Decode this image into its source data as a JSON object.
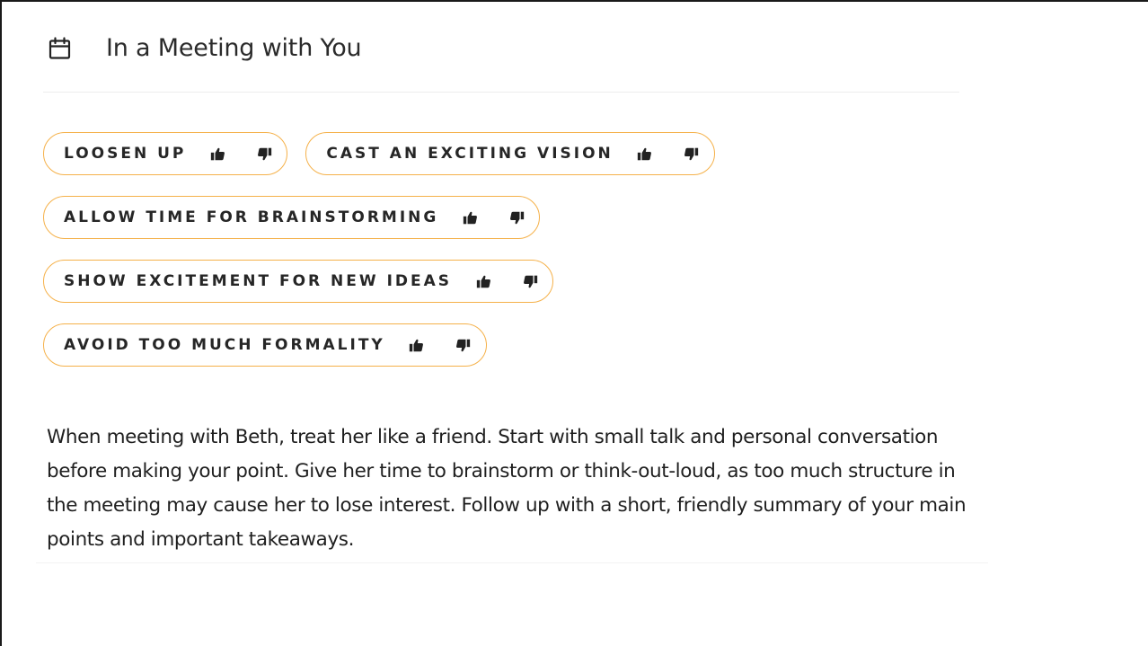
{
  "header": {
    "icon": "calendar-icon",
    "title": "In a Meeting with You"
  },
  "colors": {
    "chip_border": "#f5b14a",
    "text": "#262626"
  },
  "tips": [
    {
      "label": "LOOSEN UP",
      "up_icon": "thumbs-up-icon",
      "down_icon": "thumbs-down-icon"
    },
    {
      "label": "CAST AN EXCITING VISION",
      "up_icon": "thumbs-up-icon",
      "down_icon": "thumbs-down-icon"
    },
    {
      "label": "ALLOW TIME FOR BRAINSTORMING",
      "up_icon": "thumbs-up-icon",
      "down_icon": "thumbs-down-icon"
    },
    {
      "label": "SHOW EXCITEMENT FOR NEW IDEAS",
      "up_icon": "thumbs-up-icon",
      "down_icon": "thumbs-down-icon"
    },
    {
      "label": "AVOID TOO MUCH FORMALITY",
      "up_icon": "thumbs-up-icon",
      "down_icon": "thumbs-down-icon"
    }
  ],
  "description": "When meeting with Beth, treat her like a friend. Start with small talk and personal conversation before making your point. Give her time to brainstorm or think-out-loud, as too much structure in the meeting may cause her to lose interest. Follow up with a short, friendly summary of your main points and important takeaways."
}
